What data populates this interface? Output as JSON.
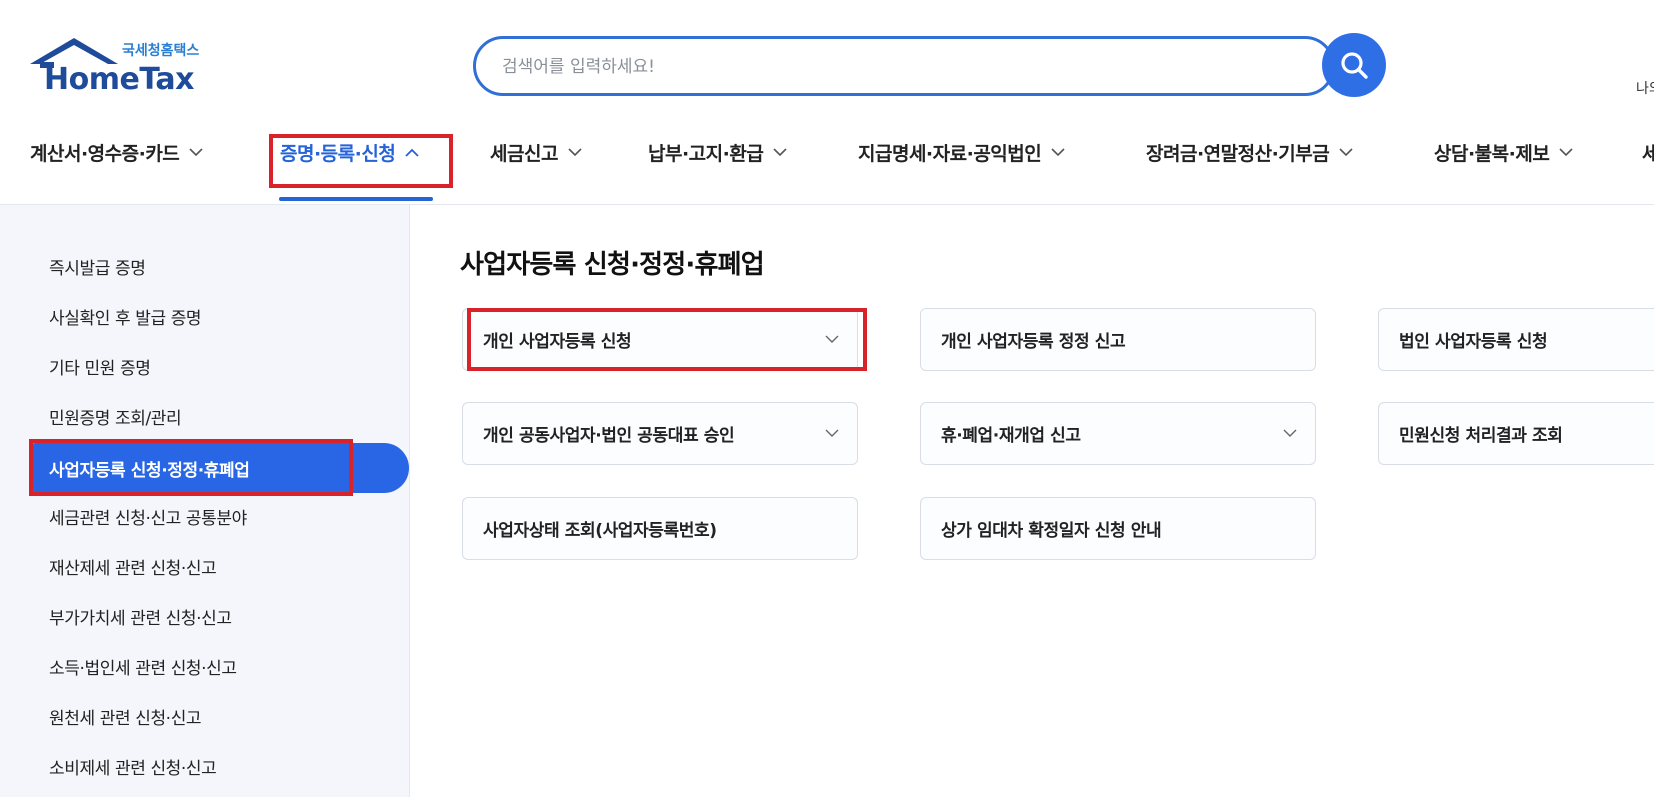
{
  "logo": {
    "brand": "HomeTax",
    "subtitle": "국세청홈택스"
  },
  "search": {
    "placeholder": "검색어를 입력하세요!"
  },
  "header": {
    "user_text": "나의"
  },
  "nav": {
    "items": [
      {
        "label": "계산서·영수증·카드",
        "active": false
      },
      {
        "label": "증명·등록·신청",
        "active": true
      },
      {
        "label": "세금신고",
        "active": false
      },
      {
        "label": "납부·고지·환급",
        "active": false
      },
      {
        "label": "지급명세·자료·공익법인",
        "active": false
      },
      {
        "label": "장려금·연말정산·기부금",
        "active": false
      },
      {
        "label": "상담·불복·제보",
        "active": false
      },
      {
        "label": "세",
        "active": false
      }
    ]
  },
  "sidebar": {
    "items": [
      {
        "label": "즉시발급 증명"
      },
      {
        "label": "사실확인 후 발급 증명"
      },
      {
        "label": "기타 민원 증명"
      },
      {
        "label": "민원증명 조회/관리"
      },
      {
        "label": "사업자등록 신청·정정·휴폐업",
        "active": true
      },
      {
        "label": "세금관련 신청·신고 공통분야"
      },
      {
        "label": "재산제세 관련 신청·신고"
      },
      {
        "label": "부가가치세 관련 신청·신고"
      },
      {
        "label": "소득·법인세 관련 신청·신고"
      },
      {
        "label": "원천세 관련 신청·신고"
      },
      {
        "label": "소비제세 관련 신청·신고"
      }
    ]
  },
  "main": {
    "title": "사업자등록 신청·정정·휴폐업",
    "cards": [
      {
        "label": "개인 사업자등록 신청",
        "has_dropdown": true
      },
      {
        "label": "개인 사업자등록 정정 신고",
        "has_dropdown": false
      },
      {
        "label": "법인 사업자등록 신청",
        "has_dropdown": false
      },
      {
        "label": "개인 공동사업자·법인 공동대표 승인",
        "has_dropdown": true
      },
      {
        "label": "휴·폐업·재개업 신고",
        "has_dropdown": true
      },
      {
        "label": "민원신청 처리결과 조회",
        "has_dropdown": false
      },
      {
        "label": "사업자상태 조회(사업자등록번호)",
        "has_dropdown": false
      },
      {
        "label": "상가 임대차 확정일자 신청 안내",
        "has_dropdown": false
      }
    ]
  },
  "colors": {
    "accent": "#2563d8",
    "highlight_box": "#d9232b",
    "sidebar_bg": "#f4f6fb",
    "logo_navy": "#1e4b9a"
  }
}
